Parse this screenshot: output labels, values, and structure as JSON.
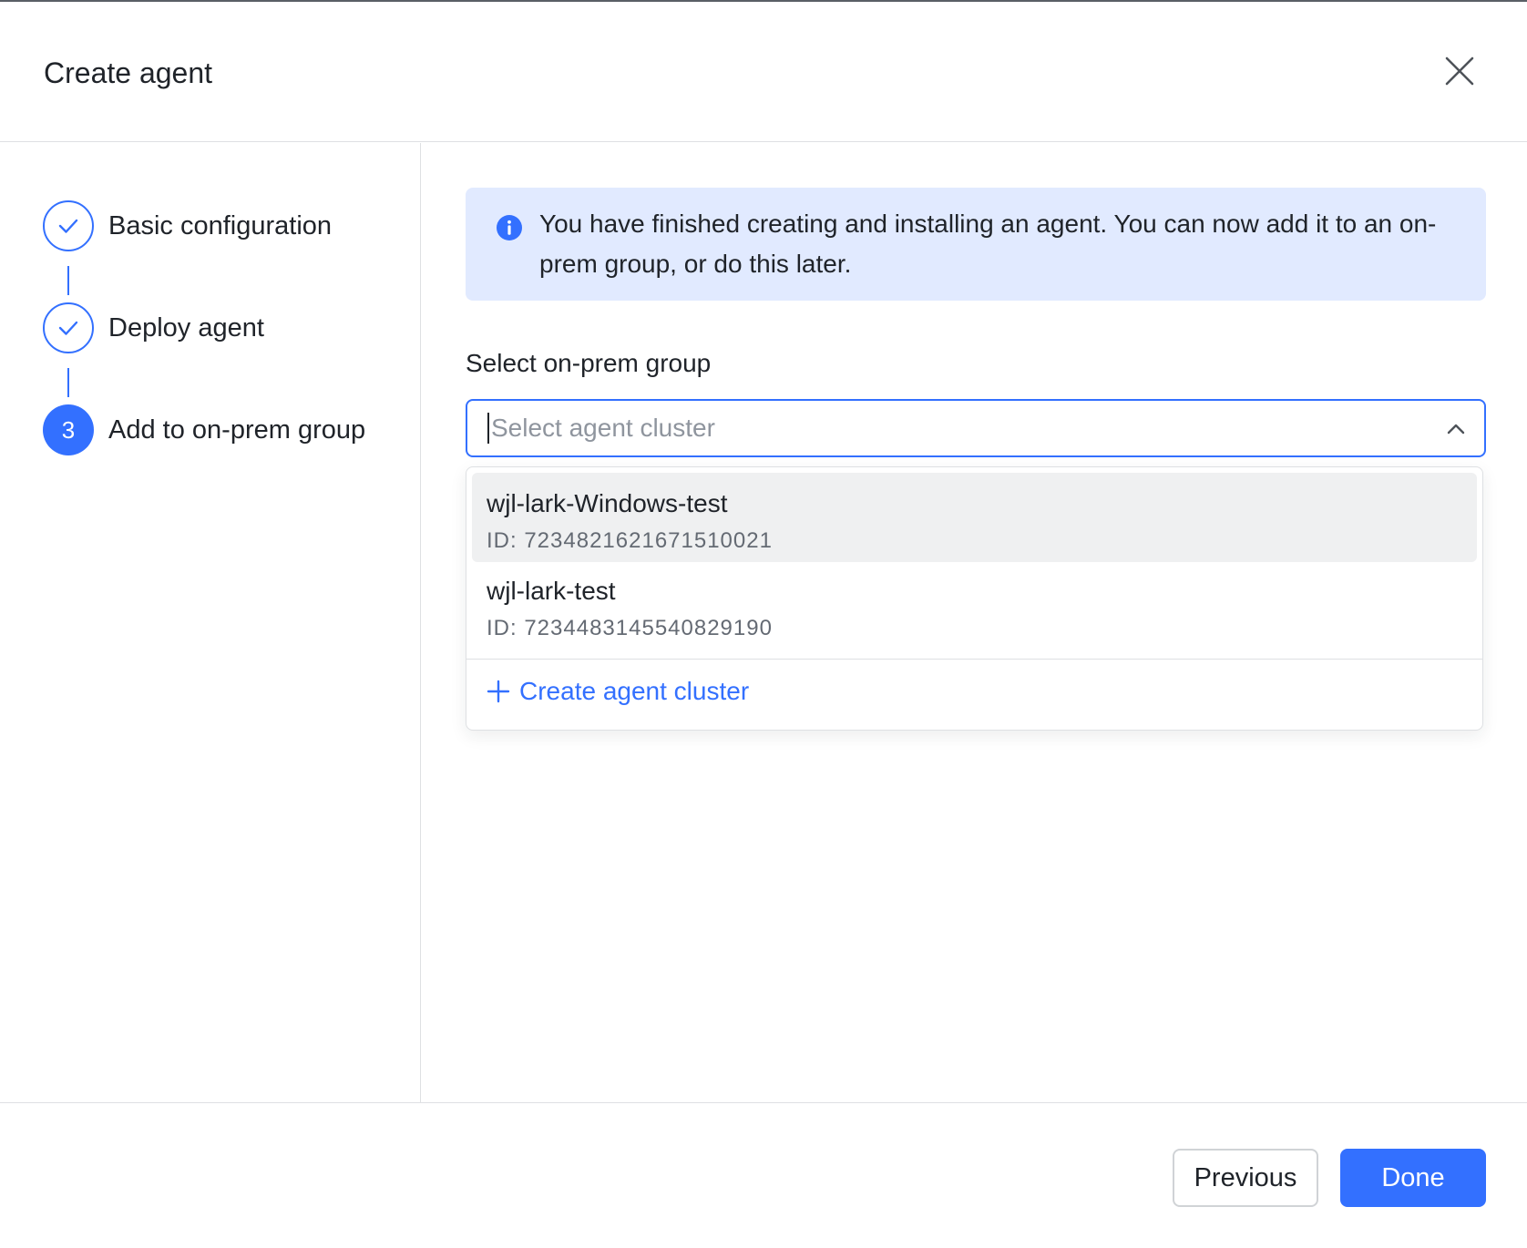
{
  "modal": {
    "title": "Create agent"
  },
  "steps": [
    {
      "label": "Basic configuration",
      "status": "done"
    },
    {
      "label": "Deploy agent",
      "status": "done"
    },
    {
      "label": "Add to on-prem group",
      "status": "active",
      "number": "3"
    }
  ],
  "banner": {
    "icon": "info-icon",
    "text": "You have finished creating and installing an agent. You can now add it to an on-prem group, or do this later."
  },
  "form": {
    "label": "Select on-prem group",
    "placeholder": "Select agent cluster",
    "value": ""
  },
  "dropdown": {
    "options": [
      {
        "name": "wjl-lark-Windows-test",
        "id": "ID: 7234821621671510021",
        "hovered": true
      },
      {
        "name": "wjl-lark-test",
        "id": "ID: 7234483145540829190",
        "hovered": false
      }
    ],
    "create_label": "Create agent cluster"
  },
  "footer": {
    "previous_label": "Previous",
    "done_label": "Done"
  },
  "colors": {
    "accent": "#3370ff",
    "banner_bg": "#e1eaff",
    "hover_bg": "#eff0f1",
    "border": "#dee0e3"
  }
}
